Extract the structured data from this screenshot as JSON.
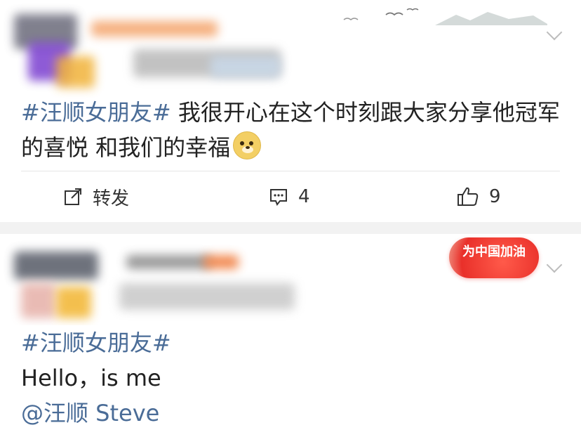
{
  "posts": [
    {
      "topic": "#汪顺女朋友#",
      "text_line1": " 我很开心在这个时刻跟大家分享他冠军",
      "text_line2": "的喜悦 和我们的幸福",
      "emoji": "doge-emoji",
      "actions": {
        "repost_label": "转发",
        "comment_count": "4",
        "like_count": "9"
      }
    },
    {
      "topic": "#汪顺女朋友#",
      "text": "Hello，is me",
      "mention": "@汪顺 Steve",
      "badge_label": "为中国加油"
    }
  ],
  "colors": {
    "link": "#4a6c97",
    "badge_red": "#e9302a",
    "background": "#f2f2f2"
  }
}
